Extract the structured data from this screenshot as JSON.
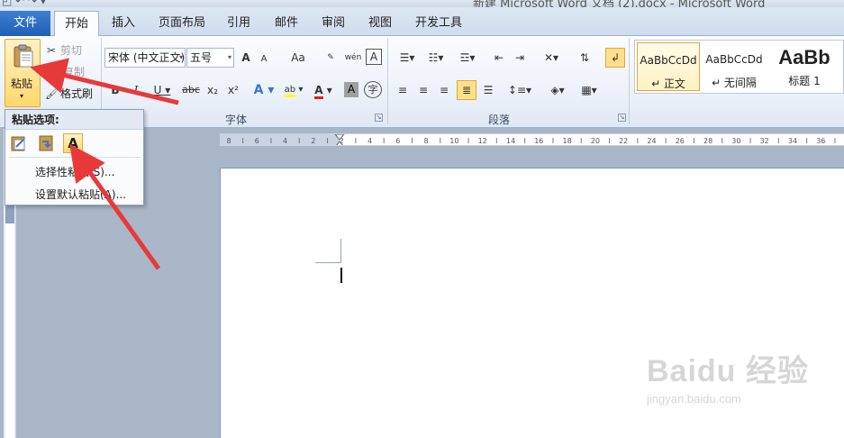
{
  "window": {
    "title": "新建 Microsoft Word 文档 (2).docx - Microsoft Word"
  },
  "tabs": {
    "file": "文件",
    "items": [
      "开始",
      "插入",
      "页面布局",
      "引用",
      "邮件",
      "审阅",
      "视图",
      "开发工具"
    ],
    "active": "开始"
  },
  "clipboard": {
    "paste": "粘贴",
    "cut": "剪切",
    "copy": "复制",
    "format_painter": "格式刷"
  },
  "font": {
    "group_label": "字体",
    "font_name": "宋体 (中文正文)",
    "font_size": "五号",
    "grow": "A",
    "shrink": "A",
    "change_case": "Aa",
    "bold": "B",
    "italic": "I",
    "underline": "U",
    "strike": "abc",
    "subscript": "x₂",
    "superscript": "x²",
    "highlight": "ab",
    "font_color": "A",
    "char_shading": "A",
    "enclose": "字",
    "phonetic": "wén",
    "border_char": "A"
  },
  "paragraph": {
    "group_label": "段落"
  },
  "styles": {
    "items": [
      {
        "sample": "AaBbCcDd",
        "name": "↵ 正文"
      },
      {
        "sample": "AaBbCcDd",
        "name": "↵ 无间隔"
      },
      {
        "sample": "AaBb",
        "name": "标题 1"
      }
    ]
  },
  "ruler": {
    "labels": [
      "8",
      "6",
      "4",
      "2",
      "2",
      "4",
      "6",
      "8",
      "10",
      "12",
      "14",
      "16",
      "18",
      "20",
      "22",
      "24",
      "26",
      "28",
      "30",
      "32",
      "34",
      "36"
    ]
  },
  "paste_options": {
    "title": "粘贴选项:",
    "icons": [
      "keep-source-formatting-icon",
      "merge-formatting-icon",
      "keep-text-only-icon"
    ],
    "text_only_glyph": "A",
    "items": [
      "选择性粘贴(S)...",
      "设置默认粘贴(A)..."
    ]
  },
  "watermark": {
    "brand": "Baidu 经验",
    "url": "jingyan.baidu.com"
  },
  "colors": {
    "accent_file_tab": "#2a6cc3",
    "highlight_border": "#e1a73b",
    "annotation_red": "#e8393a"
  }
}
